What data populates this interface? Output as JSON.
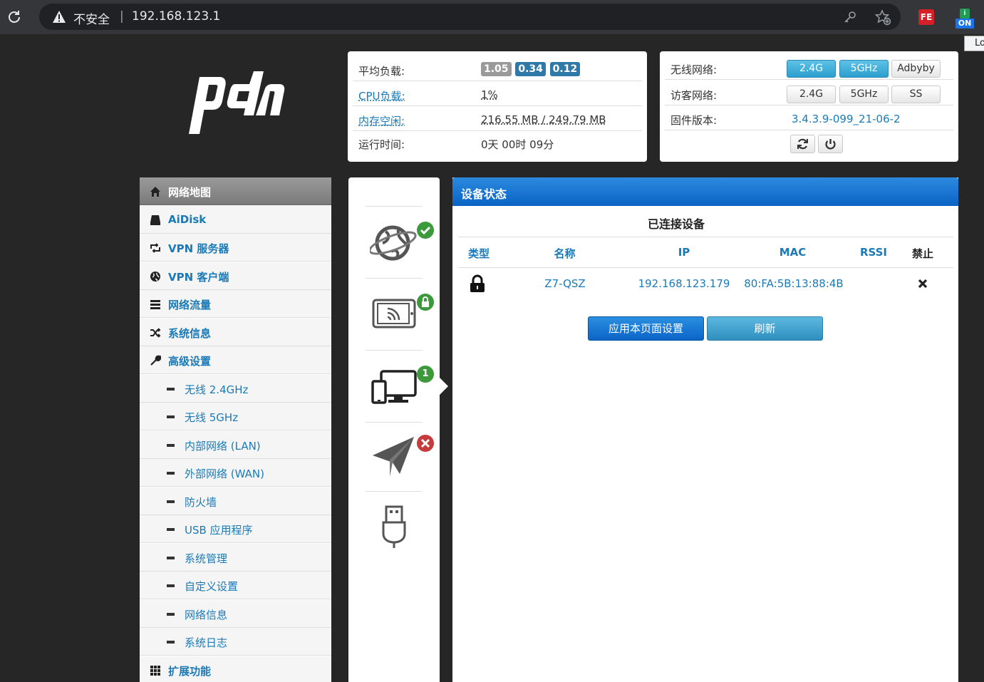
{
  "browser": {
    "security_label": "不安全",
    "separator": "|",
    "url": "192.168.123.1",
    "extension_fe_label": "FE",
    "extension_on_label": "ON",
    "tooltip_fragment": "Lo"
  },
  "status_panel": {
    "load_label": "平均负载:",
    "load_values": [
      "1.05",
      "0.34",
      "0.12"
    ],
    "cpu_label": "CPU负载:",
    "cpu_value": "1%",
    "mem_label": "内存空闲:",
    "mem_value": "216.55 MB / 249.79 MB",
    "uptime_label": "运行时间:",
    "uptime_value": "0天 00时 09分"
  },
  "wireless_panel": {
    "wifi_label": "无线网络:",
    "wifi_buttons": [
      "2.4G",
      "5GHz",
      "Adbyby"
    ],
    "guest_label": "访客网络:",
    "guest_buttons": [
      "2.4G",
      "5GHz",
      "SS"
    ],
    "firmware_label": "固件版本:",
    "firmware_value": "3.4.3.9-099_21-06-2"
  },
  "menu": {
    "items": [
      {
        "label": "网络地图",
        "icon": "home-icon"
      },
      {
        "label": "AiDisk",
        "icon": "disk-icon"
      },
      {
        "label": "VPN 服务器",
        "icon": "retweet-icon"
      },
      {
        "label": "VPN 客户端",
        "icon": "globe-icon"
      },
      {
        "label": "网络流量",
        "icon": "list-icon"
      },
      {
        "label": "系统信息",
        "icon": "shuffle-icon"
      },
      {
        "label": "高级设置",
        "icon": "wrench-icon"
      },
      {
        "label": "无线 2.4GHz"
      },
      {
        "label": "无线 5GHz"
      },
      {
        "label": "内部网络 (LAN)"
      },
      {
        "label": "外部网络 (WAN)"
      },
      {
        "label": "防火墙"
      },
      {
        "label": "USB 应用程序"
      },
      {
        "label": "系统管理"
      },
      {
        "label": "自定义设置"
      },
      {
        "label": "网络信息"
      },
      {
        "label": "系统日志"
      },
      {
        "label": "扩展功能",
        "icon": "grid-icon"
      }
    ]
  },
  "icon_column": {
    "client_count": "1"
  },
  "main": {
    "title": "设备状态",
    "subtitle": "已连接设备",
    "columns": [
      "类型",
      "名称",
      "IP",
      "MAC",
      "RSSI",
      "禁止"
    ],
    "rows": [
      {
        "name": "Z7-QSZ",
        "ip": "192.168.123.179",
        "mac": "80:FA:5B:13:88:4B",
        "rssi": ""
      }
    ],
    "apply_label": "应用本页面设置",
    "refresh_label": "刷新"
  }
}
